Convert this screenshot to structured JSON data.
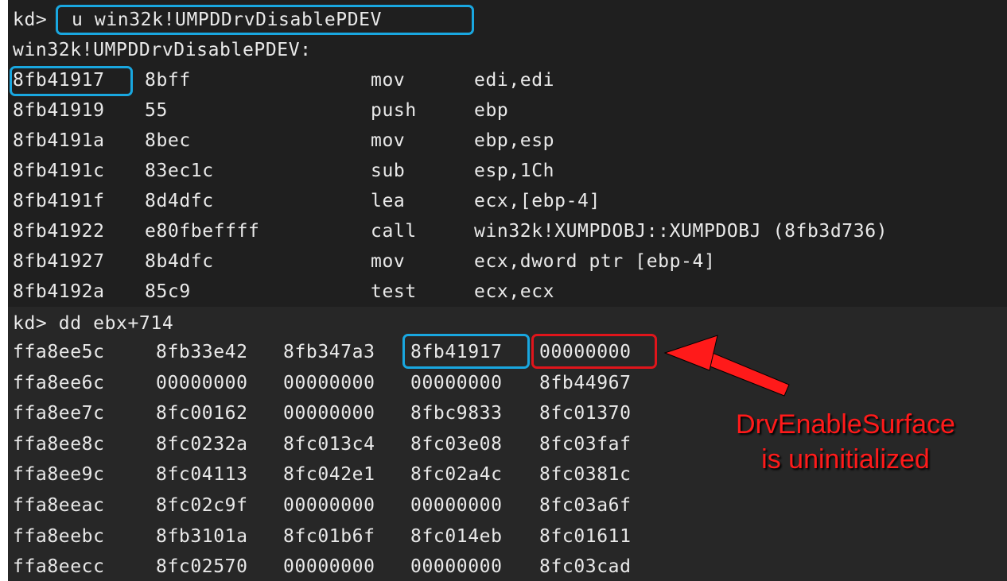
{
  "prompt": "kd>",
  "command": "u win32k!UMPDDrvDisablePDEV",
  "function_label": "win32k!UMPDDrvDisablePDEV:",
  "disasm": [
    {
      "addr": "8fb41917",
      "bytes": "8bff",
      "mnemonic": "mov",
      "operands": "edi,edi"
    },
    {
      "addr": "8fb41919",
      "bytes": "55",
      "mnemonic": "push",
      "operands": "ebp"
    },
    {
      "addr": "8fb4191a",
      "bytes": "8bec",
      "mnemonic": "mov",
      "operands": "ebp,esp"
    },
    {
      "addr": "8fb4191c",
      "bytes": "83ec1c",
      "mnemonic": "sub",
      "operands": "esp,1Ch"
    },
    {
      "addr": "8fb4191f",
      "bytes": "8d4dfc",
      "mnemonic": "lea",
      "operands": "ecx,[ebp-4]"
    },
    {
      "addr": "8fb41922",
      "bytes": "e80fbeffff",
      "mnemonic": "call",
      "operands": "win32k!XUMPDOBJ::XUMPDOBJ (8fb3d736)"
    },
    {
      "addr": "8fb41927",
      "bytes": "8b4dfc",
      "mnemonic": "mov",
      "operands": "ecx,dword ptr [ebp-4]"
    },
    {
      "addr": "8fb4192a",
      "bytes": "85c9",
      "mnemonic": "test",
      "operands": "ecx,ecx"
    }
  ],
  "dump_command": "kd> dd ebx+714",
  "dump": [
    {
      "addr": "ffa8ee5c",
      "values": [
        "8fb33e42",
        "8fb347a3",
        "8fb41917",
        "00000000"
      ]
    },
    {
      "addr": "ffa8ee6c",
      "values": [
        "00000000",
        "00000000",
        "00000000",
        "8fb44967"
      ]
    },
    {
      "addr": "ffa8ee7c",
      "values": [
        "8fc00162",
        "00000000",
        "8fbc9833",
        "8fc01370"
      ]
    },
    {
      "addr": "ffa8ee8c",
      "values": [
        "8fc0232a",
        "8fc013c4",
        "8fc03e08",
        "8fc03faf"
      ]
    },
    {
      "addr": "ffa8ee9c",
      "values": [
        "8fc04113",
        "8fc042e1",
        "8fc02a4c",
        "8fc0381c"
      ]
    },
    {
      "addr": "ffa8eeac",
      "values": [
        "8fc02c9f",
        "00000000",
        "00000000",
        "8fc03a6f"
      ]
    },
    {
      "addr": "ffa8eebc",
      "values": [
        "8fb3101a",
        "8fc01b6f",
        "8fc014eb",
        "8fc01611"
      ]
    },
    {
      "addr": "ffa8eecc",
      "values": [
        "8fc02570",
        "00000000",
        "00000000",
        "8fc03cad"
      ]
    }
  ],
  "annotation": {
    "line1": "DrvEnableSurface",
    "line2": "is uninitialized"
  },
  "colors": {
    "highlight": "#19a7e0",
    "alert": "#e0151b",
    "background": "#1f1f1f",
    "text": "#e9e9e9"
  }
}
